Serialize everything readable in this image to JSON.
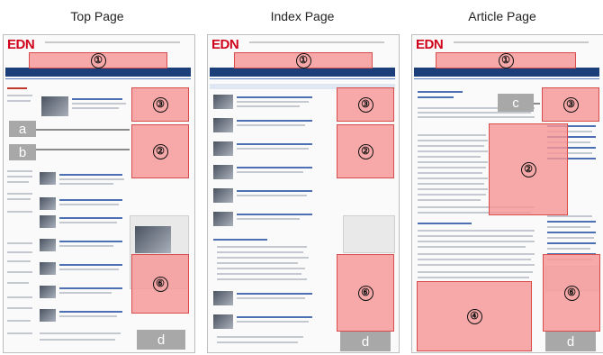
{
  "columns": [
    {
      "title": "Top Page",
      "logo": "EDN",
      "regions": [
        "①",
        "③",
        "②",
        "⑥"
      ],
      "tags": [
        "a",
        "b",
        "d"
      ]
    },
    {
      "title": "Index Page",
      "logo": "EDN",
      "regions": [
        "①",
        "③",
        "②",
        "⑥"
      ],
      "tags": [
        "d"
      ]
    },
    {
      "title": "Article Page",
      "logo": "EDN",
      "regions": [
        "①",
        "③",
        "②",
        "④",
        "⑥"
      ],
      "tags": [
        "c",
        "d"
      ]
    }
  ]
}
